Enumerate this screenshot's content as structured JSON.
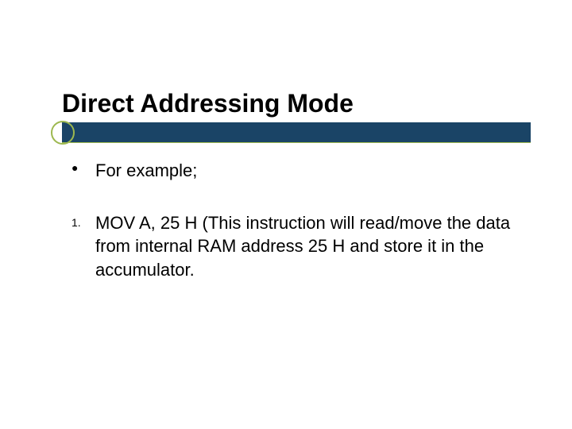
{
  "slide": {
    "title": "Direct Addressing Mode",
    "bullets": [
      {
        "marker": "●",
        "text": "For example;"
      }
    ],
    "numbered": [
      {
        "marker": "1.",
        "text": "MOV A, 25 H (This instruction will read/move the data from internal RAM address 25 H and store it in the accumulator."
      }
    ],
    "accent_color": "#9db84f",
    "bar_color": "#1a4466"
  }
}
